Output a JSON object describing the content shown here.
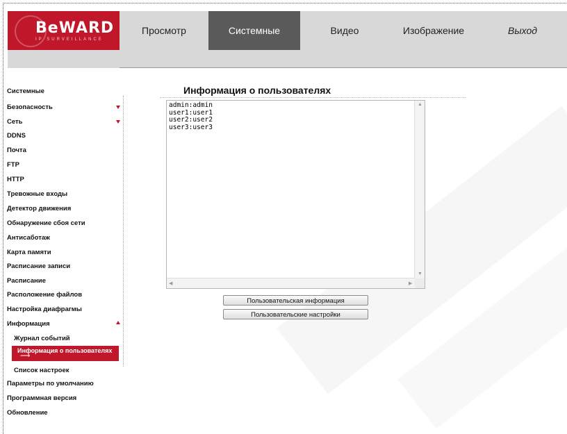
{
  "brand": {
    "name": "BeWARD",
    "tagline": "IP SURVEILLANCE",
    "color": "#c0172b"
  },
  "nav": {
    "items": [
      {
        "label": "Просмотр"
      },
      {
        "label": "Системные"
      },
      {
        "label": "Видео"
      },
      {
        "label": "Изображение"
      },
      {
        "label": "Выход"
      }
    ],
    "active": "Системные"
  },
  "sidebar": {
    "items": [
      {
        "label": "Системные"
      },
      {
        "label": "Безопасность",
        "arrow": "down"
      },
      {
        "label": "Сеть",
        "arrow": "down"
      },
      {
        "label": "DDNS"
      },
      {
        "label": "Почта"
      },
      {
        "label": "FTP"
      },
      {
        "label": "HTTP"
      },
      {
        "label": "Тревожные входы"
      },
      {
        "label": "Детектор движения"
      },
      {
        "label": "Обнаружение сбоя сети"
      },
      {
        "label": "Антисаботаж"
      },
      {
        "label": "Карта памяти"
      },
      {
        "label": "Расписание записи"
      },
      {
        "label": "Расписание"
      },
      {
        "label": "Расположение файлов"
      },
      {
        "label": "Настройка диафрагмы"
      },
      {
        "label": "Информация",
        "arrow": "up"
      },
      {
        "label": "Журнал событий"
      },
      {
        "label": "Информация о пользователях",
        "selected": true
      },
      {
        "label": "Список настроек"
      },
      {
        "label": "Параметры по умолчанию"
      },
      {
        "label": "Программная версия"
      },
      {
        "label": "Обновление"
      }
    ]
  },
  "main": {
    "title": "Информация о пользователях",
    "user_lines": [
      "admin:admin",
      "user1:user1",
      "user2:user2",
      "user3:user3"
    ],
    "buttons": {
      "user_info": "Пользовательская информация",
      "user_settings": "Пользовательские настройки"
    }
  }
}
